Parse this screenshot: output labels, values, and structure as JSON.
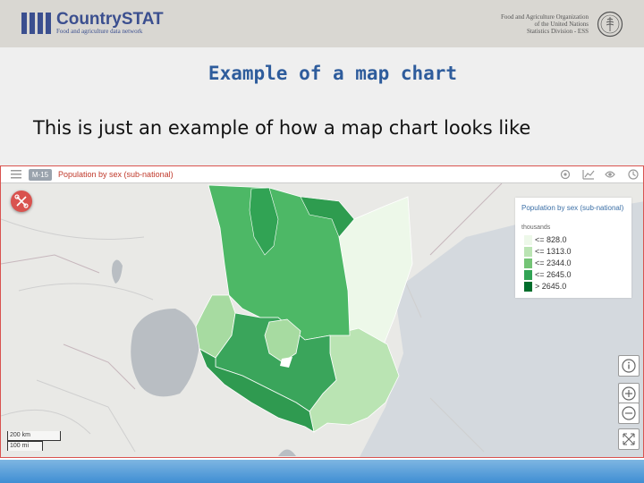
{
  "header": {
    "brand_name": "CountrySTAT",
    "brand_tagline": "Food and agriculture data network",
    "org_line1": "Food and Agriculture Organization",
    "org_line2": "of the United Nations",
    "org_line3": "Statistics Division - ESS"
  },
  "slide": {
    "title": "Example of a map chart",
    "subtitle": "This is just an example of how a map chart looks like"
  },
  "map": {
    "badge": "M-15",
    "chart_title": "Population by sex (sub-national)",
    "legend": {
      "title": "Population by sex (sub-national)",
      "unit": "thousands",
      "items": [
        {
          "label": "<= 828.0",
          "color": "#edf8e9"
        },
        {
          "label": "<= 1313.0",
          "color": "#bae4b3"
        },
        {
          "label": "<= 2344.0",
          "color": "#74c476"
        },
        {
          "label": "<= 2645.0",
          "color": "#31a354"
        },
        {
          "label": "> 2645.0",
          "color": "#006d2c"
        }
      ]
    },
    "scale_km": "200 km",
    "scale_mi": "100 mi"
  },
  "icons": {
    "menu": "menu-icon",
    "download": "download-icon",
    "info": "info-icon",
    "zoom_in": "zoom-in-icon",
    "zoom_out": "zoom-out-icon",
    "fullscreen": "fullscreen-icon"
  }
}
